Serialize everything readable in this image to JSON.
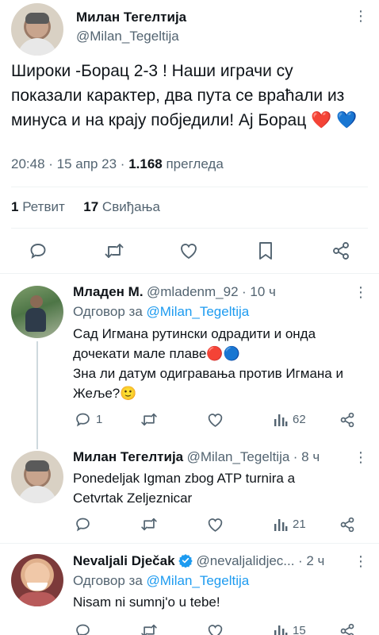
{
  "main_tweet": {
    "author_name": "Милан Тегелтија",
    "author_handle": "@Milan_Tegeltija",
    "text": "Широки -Борац 2-3 ! Наши играчи су показали карактер, два пута се враћали из минуса и на крају побједили! Ај Борац ❤️ 💙",
    "time": "20:48",
    "date": "15 апр 23",
    "views_count": "1.168",
    "views_label": "прегледа",
    "retweet_count": "1",
    "retweet_label": "Ретвит",
    "likes_count": "17",
    "likes_label": "Свиђања"
  },
  "replies": [
    {
      "author_name": "Младен М.",
      "author_handle": "@mladenm_92",
      "time": "· 10 ч",
      "reply_to_label": "Одговор за",
      "reply_to_handle": "@Milan_Tegeltija",
      "text_line1": "Сад Игмана рутински одрадити и онда",
      "text_line2": "дочекати мале плаве🔴🔵",
      "text_line3": "Зна ли датум одигравања против Игмана и",
      "text_line4": "Жеље?🙂",
      "reply_count": "1",
      "views": "62"
    },
    {
      "author_name": "Милан Тегелтија",
      "author_handle": "@Milan_Tegeltija",
      "time": "· 8 ч",
      "text_line1": "Ponedeljak Igman zbog ATP turnira a",
      "text_line2": "Cetvrtak Zeljeznicar",
      "views": "21"
    },
    {
      "author_name": "Nevaljali Dječak",
      "author_handle": "@nevaljalidjec...",
      "time": "· 2 ч",
      "reply_to_label": "Одговор за",
      "reply_to_handle": "@Milan_Tegeltija",
      "text_line1": "Nisam ni sumnj'o u tebe!",
      "views": "15"
    }
  ],
  "colors": {
    "accent": "#1d9bf0",
    "muted": "#536471",
    "verified": "#1d9bf0",
    "divider": "#eff3f4"
  }
}
